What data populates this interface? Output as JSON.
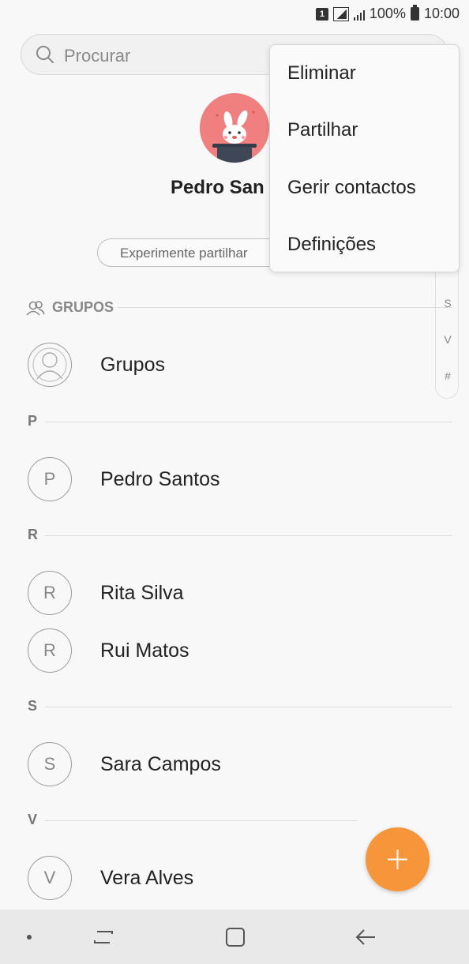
{
  "status_bar": {
    "sim": "1",
    "battery": "100%",
    "time": "10:00"
  },
  "search": {
    "placeholder": "Procurar"
  },
  "profile": {
    "name": "Pedro San",
    "share_hint": "Experimente partilhar"
  },
  "index": {
    "letters": [
      "S",
      "V",
      "#"
    ]
  },
  "groups": {
    "header": "GRUPOS",
    "item": "Grupos"
  },
  "sections": [
    {
      "letter": "P",
      "contacts": [
        {
          "initial": "P",
          "name": "Pedro Santos"
        }
      ]
    },
    {
      "letter": "R",
      "contacts": [
        {
          "initial": "R",
          "name": "Rita Silva"
        },
        {
          "initial": "R",
          "name": "Rui Matos"
        }
      ]
    },
    {
      "letter": "S",
      "contacts": [
        {
          "initial": "S",
          "name": "Sara Campos"
        }
      ]
    },
    {
      "letter": "V",
      "contacts": [
        {
          "initial": "V",
          "name": "Vera Alves"
        }
      ]
    }
  ],
  "menu": {
    "items": [
      "Eliminar",
      "Partilhar",
      "Gerir contactos",
      "Definições"
    ]
  },
  "colors": {
    "accent": "#f7953b",
    "avatar_bg": "#f08080"
  }
}
